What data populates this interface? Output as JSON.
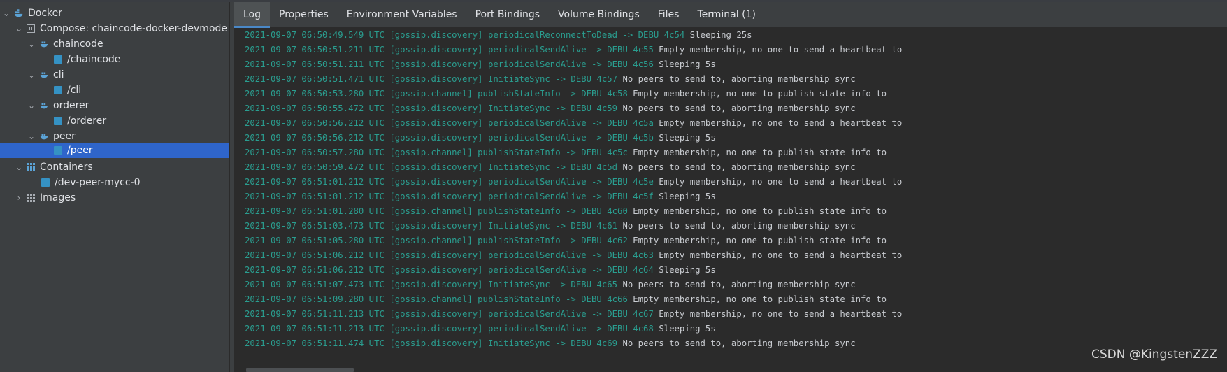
{
  "sidebar": {
    "docker": "Docker",
    "compose": "Compose: chaincode-docker-devmode",
    "services": [
      {
        "name": "chaincode",
        "container": "/chaincode"
      },
      {
        "name": "cli",
        "container": "/cli"
      },
      {
        "name": "orderer",
        "container": "/orderer"
      },
      {
        "name": "peer",
        "container": "/peer"
      }
    ],
    "containers_label": "Containers",
    "containers": [
      "/dev-peer-mycc-0"
    ],
    "images_label": "Images"
  },
  "tabs": [
    {
      "label": "Log",
      "active": true
    },
    {
      "label": "Properties"
    },
    {
      "label": "Environment Variables"
    },
    {
      "label": "Port Bindings"
    },
    {
      "label": "Volume Bindings"
    },
    {
      "label": "Files"
    },
    {
      "label": "Terminal (1)"
    }
  ],
  "log": [
    {
      "prefix": "2021-09-07 06:50:49.549 UTC [gossip.discovery] periodicalReconnectToDead -> DEBU 4c54",
      "message": "Sleeping 25s"
    },
    {
      "prefix": "2021-09-07 06:50:51.211 UTC [gossip.discovery] periodicalSendAlive -> DEBU 4c55",
      "message": "Empty membership, no one to send a heartbeat to"
    },
    {
      "prefix": "2021-09-07 06:50:51.211 UTC [gossip.discovery] periodicalSendAlive -> DEBU 4c56",
      "message": "Sleeping 5s"
    },
    {
      "prefix": "2021-09-07 06:50:51.471 UTC [gossip.discovery] InitiateSync -> DEBU 4c57",
      "message": "No peers to send to, aborting membership sync"
    },
    {
      "prefix": "2021-09-07 06:50:53.280 UTC [gossip.channel] publishStateInfo -> DEBU 4c58",
      "message": "Empty membership, no one to publish state info to"
    },
    {
      "prefix": "2021-09-07 06:50:55.472 UTC [gossip.discovery] InitiateSync -> DEBU 4c59",
      "message": "No peers to send to, aborting membership sync"
    },
    {
      "prefix": "2021-09-07 06:50:56.212 UTC [gossip.discovery] periodicalSendAlive -> DEBU 4c5a",
      "message": "Empty membership, no one to send a heartbeat to"
    },
    {
      "prefix": "2021-09-07 06:50:56.212 UTC [gossip.discovery] periodicalSendAlive -> DEBU 4c5b",
      "message": "Sleeping 5s"
    },
    {
      "prefix": "2021-09-07 06:50:57.280 UTC [gossip.channel] publishStateInfo -> DEBU 4c5c",
      "message": "Empty membership, no one to publish state info to"
    },
    {
      "prefix": "2021-09-07 06:50:59.472 UTC [gossip.discovery] InitiateSync -> DEBU 4c5d",
      "message": "No peers to send to, aborting membership sync"
    },
    {
      "prefix": "2021-09-07 06:51:01.212 UTC [gossip.discovery] periodicalSendAlive -> DEBU 4c5e",
      "message": "Empty membership, no one to send a heartbeat to"
    },
    {
      "prefix": "2021-09-07 06:51:01.212 UTC [gossip.discovery] periodicalSendAlive -> DEBU 4c5f",
      "message": "Sleeping 5s"
    },
    {
      "prefix": "2021-09-07 06:51:01.280 UTC [gossip.channel] publishStateInfo -> DEBU 4c60",
      "message": "Empty membership, no one to publish state info to"
    },
    {
      "prefix": "2021-09-07 06:51:03.473 UTC [gossip.discovery] InitiateSync -> DEBU 4c61",
      "message": "No peers to send to, aborting membership sync"
    },
    {
      "prefix": "2021-09-07 06:51:05.280 UTC [gossip.channel] publishStateInfo -> DEBU 4c62",
      "message": "Empty membership, no one to publish state info to"
    },
    {
      "prefix": "2021-09-07 06:51:06.212 UTC [gossip.discovery] periodicalSendAlive -> DEBU 4c63",
      "message": "Empty membership, no one to send a heartbeat to"
    },
    {
      "prefix": "2021-09-07 06:51:06.212 UTC [gossip.discovery] periodicalSendAlive -> DEBU 4c64",
      "message": "Sleeping 5s"
    },
    {
      "prefix": "2021-09-07 06:51:07.473 UTC [gossip.discovery] InitiateSync -> DEBU 4c65",
      "message": "No peers to send to, aborting membership sync"
    },
    {
      "prefix": "2021-09-07 06:51:09.280 UTC [gossip.channel] publishStateInfo -> DEBU 4c66",
      "message": "Empty membership, no one to publish state info to"
    },
    {
      "prefix": "2021-09-07 06:51:11.213 UTC [gossip.discovery] periodicalSendAlive -> DEBU 4c67",
      "message": "Empty membership, no one to send a heartbeat to"
    },
    {
      "prefix": "2021-09-07 06:51:11.213 UTC [gossip.discovery] periodicalSendAlive -> DEBU 4c68",
      "message": "Sleeping 5s"
    },
    {
      "prefix": "2021-09-07 06:51:11.474 UTC [gossip.discovery] InitiateSync -> DEBU 4c69",
      "message": "No peers to send to, aborting membership sync"
    }
  ],
  "watermark": "CSDN @KingstenZZZ",
  "colors": {
    "accent": "#2f65ca",
    "timestamp": "#2a9d8f",
    "docker_blue": "#3592c4"
  }
}
